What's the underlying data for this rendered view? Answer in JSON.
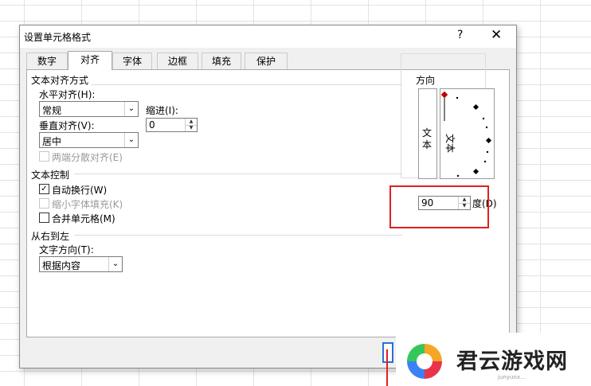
{
  "dialog": {
    "title": "设置单元格格式",
    "help_label": "?",
    "close_label": "✕"
  },
  "tabs": [
    {
      "label": "数字"
    },
    {
      "label": "对齐"
    },
    {
      "label": "字体"
    },
    {
      "label": "边框"
    },
    {
      "label": "填充"
    },
    {
      "label": "保护"
    }
  ],
  "active_tab": "对齐",
  "text_alignment": {
    "group_title": "文本对齐方式",
    "horizontal_label": "水平对齐(H):",
    "horizontal_value": "常规",
    "vertical_label": "垂直对齐(V):",
    "vertical_value": "居中",
    "indent_label": "缩进(I):",
    "indent_value": "0",
    "justify_distributed_label": "两端分散对齐(E)"
  },
  "text_control": {
    "group_title": "文本控制",
    "wrap_text_label": "自动换行(W)",
    "wrap_text_checked": true,
    "shrink_to_fit_label": "缩小字体填充(K)",
    "merge_cells_label": "合并单元格(M)"
  },
  "rtl": {
    "group_title": "从右到左",
    "direction_label": "文字方向(T):",
    "direction_value": "根据内容"
  },
  "orientation": {
    "group_title": "方向",
    "vertical_text": "文本",
    "dial_text": "文本",
    "degrees_value": "90",
    "degrees_label": "度(D)"
  },
  "watermark": {
    "text": "君云游戏网",
    "url": "junyunx..."
  },
  "colors": {
    "highlight": "#e02020",
    "ok_button_border": "#2a6fd6",
    "dial_marker": "#c00000"
  }
}
